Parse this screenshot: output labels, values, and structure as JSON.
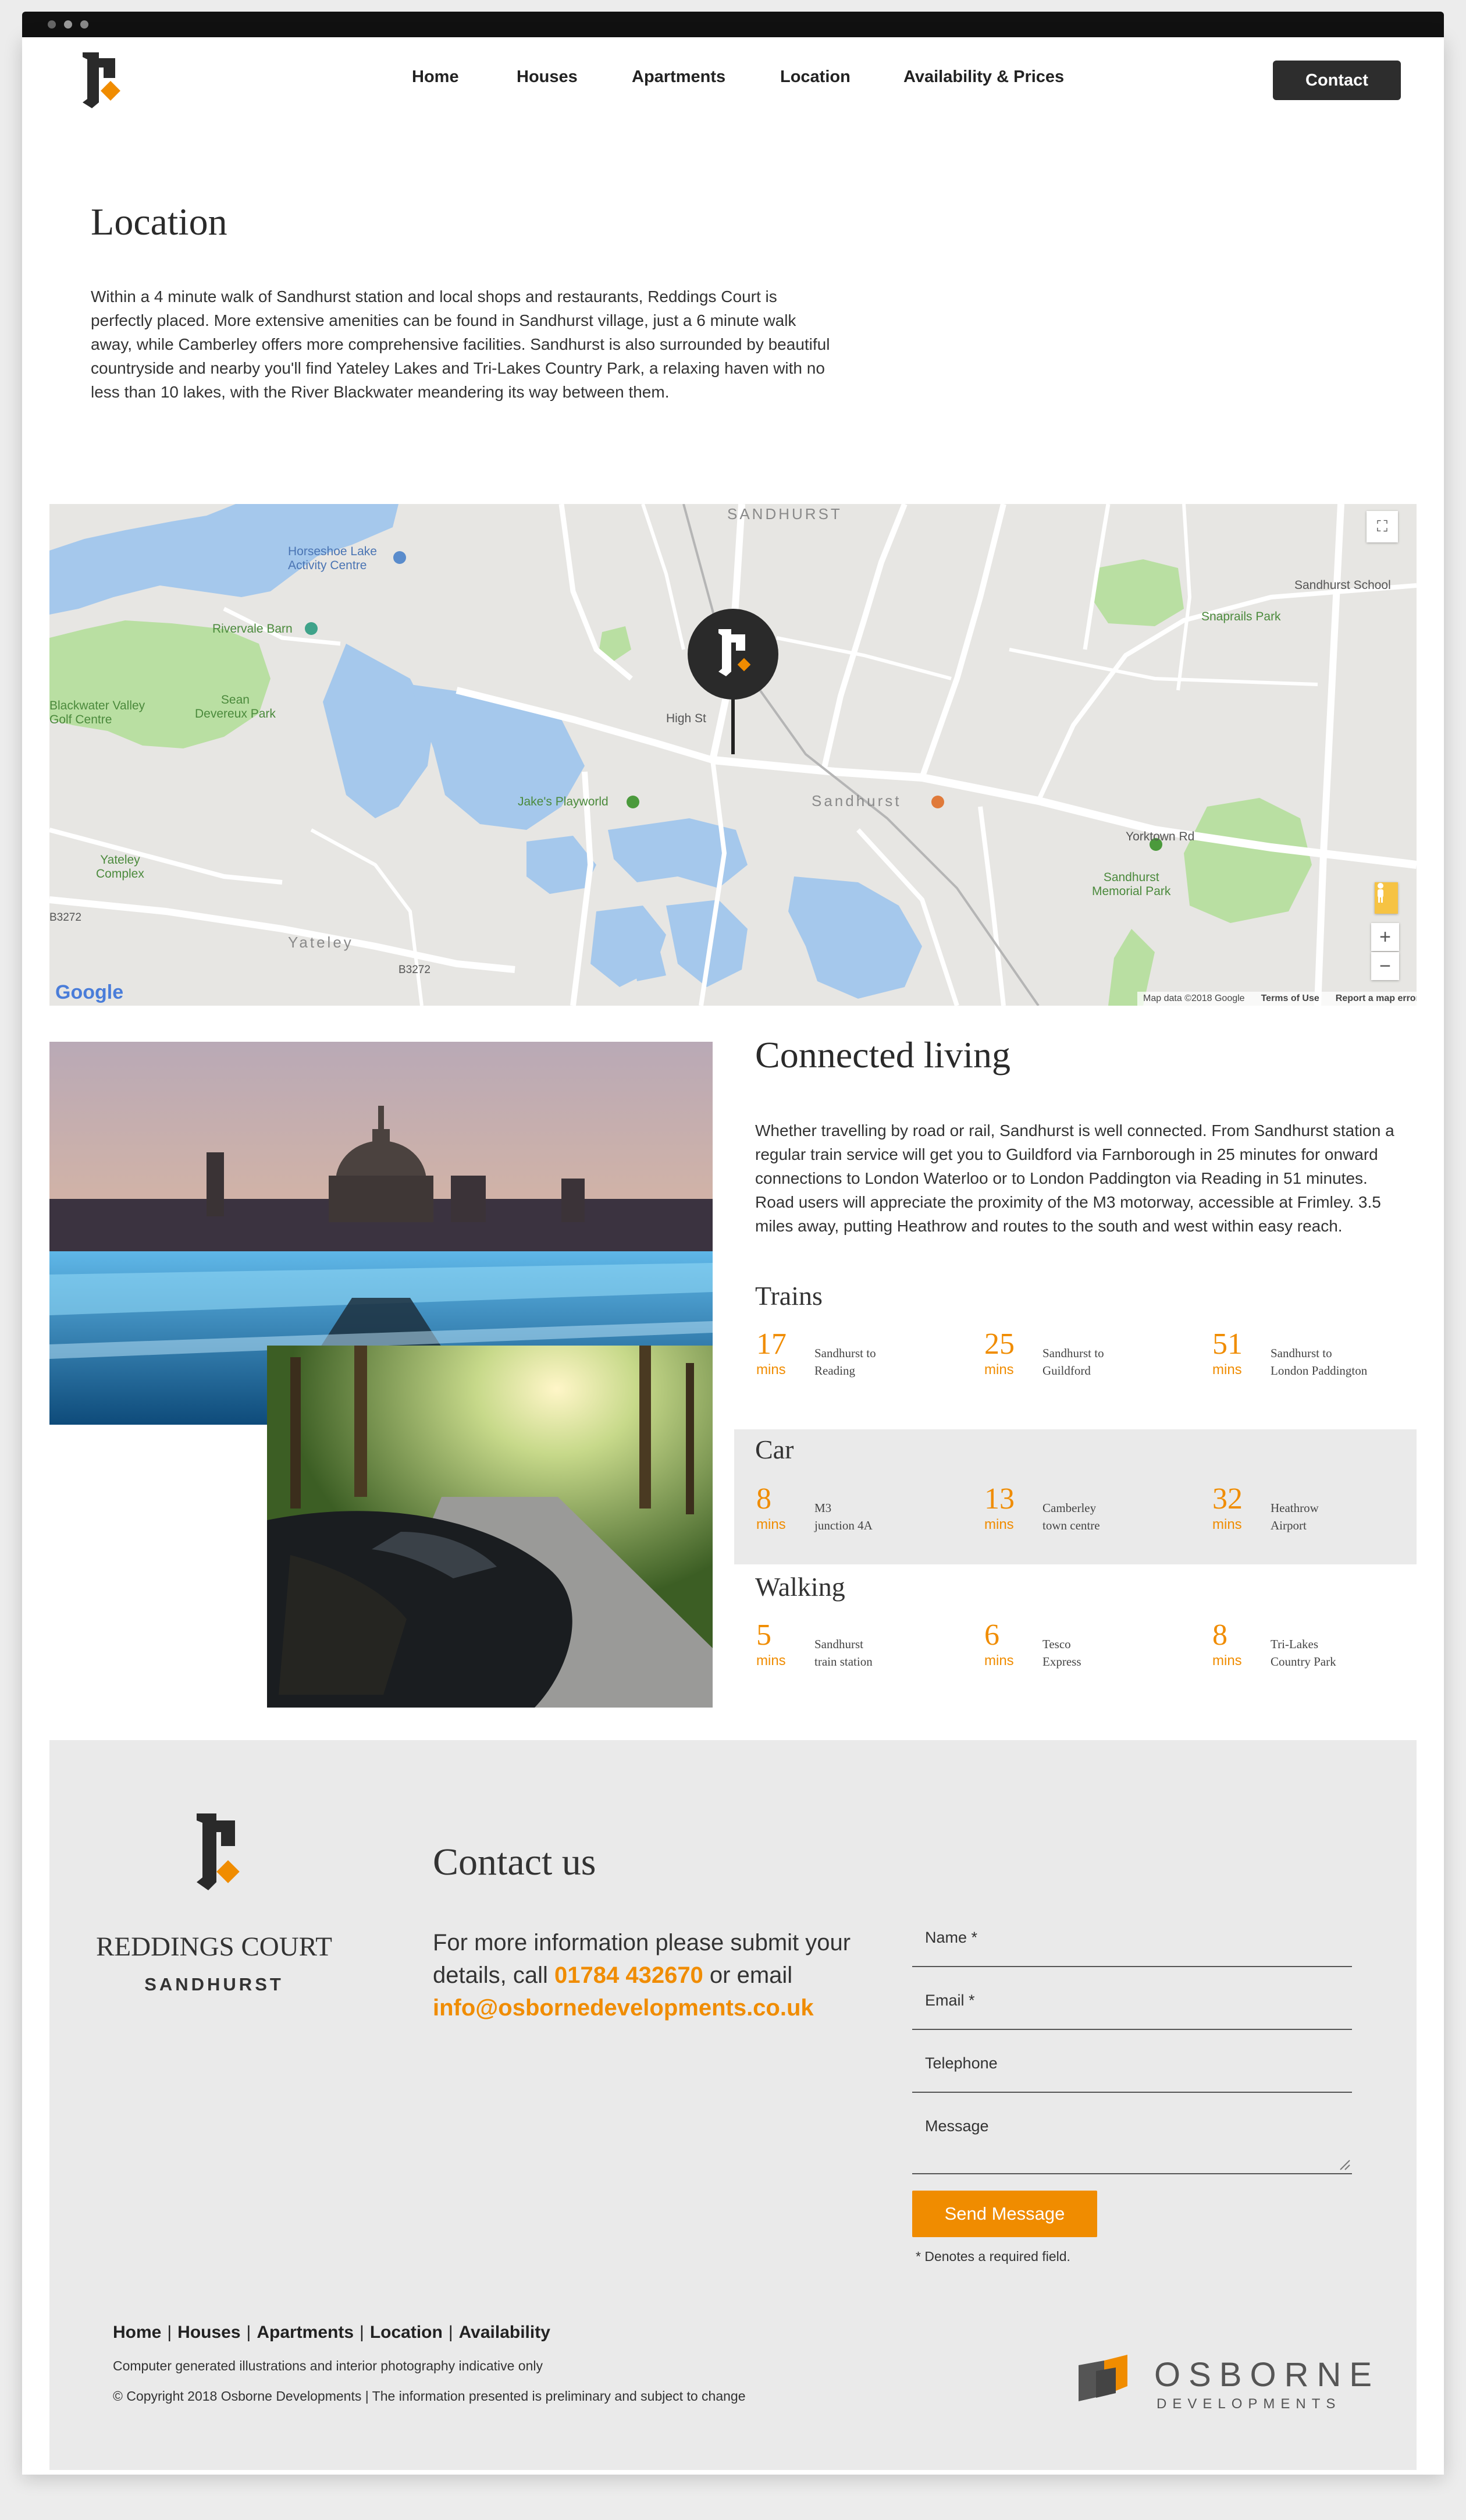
{
  "nav": {
    "items": [
      "Home",
      "Houses",
      "Apartments",
      "Location",
      "Availability & Prices"
    ],
    "contact_button": "Contact"
  },
  "location": {
    "title": "Location",
    "text": "Within a 4 minute walk of Sandhurst station and local shops and restaurants, Reddings Court is perfectly placed. More extensive amenities can be found in Sandhurst village, just a 6 minute walk away, while Camberley offers more comprehensive facilities. Sandhurst is also surrounded by beautiful countryside and nearby you'll find Yateley Lakes and Tri-Lakes Country Park, a relaxing haven with no less than 10 lakes, with the River Blackwater meandering its way between them."
  },
  "map": {
    "labels": {
      "sandhurst_top": "SANDHURST",
      "horseshoe": "Horseshoe Lake\nActivity Centre",
      "rivervale": "Rivervale Barn",
      "blackwater": "Blackwater Valley\nGolf Centre",
      "sean": "Sean\nDevereux Park",
      "snaprails": "Snaprails Park",
      "sandhurst_school": "Sandhurst School",
      "jakes": "Jake's Playworld",
      "sandhurst_town": "Sandhurst",
      "memorial": "Sandhurst\nMemorial Park",
      "yateley_complex": "Yateley\nComplex",
      "yateley": "Yateley",
      "high_st": "High St",
      "yorktown": "Yorktown Rd",
      "b3272a": "B3272",
      "b3272b": "B3272"
    },
    "attribution": "Map data ©2018 Google",
    "terms": "Terms of Use",
    "report": "Report a map error",
    "google": "Google",
    "zoom_in": "+",
    "zoom_out": "−"
  },
  "connected": {
    "title": "Connected living",
    "text": "Whether travelling by road or rail, Sandhurst is well connected. From Sandhurst station a regular train service will get you to Guildford via Farnborough in 25 minutes for onward connections to London Waterloo or to London Paddington via Reading in 51 minutes. Road users will appreciate the proximity of the M3 motorway, accessible at Frimley. 3.5 miles away, putting Heathrow and routes to the south and west within easy reach.",
    "groups": [
      {
        "title": "Trains",
        "stats": [
          {
            "num": "17",
            "unit": "mins",
            "desc": "Sandhurst to\nReading"
          },
          {
            "num": "25",
            "unit": "mins",
            "desc": "Sandhurst to\nGuildford"
          },
          {
            "num": "51",
            "unit": "mins",
            "desc": "Sandhurst to\nLondon Paddington"
          }
        ]
      },
      {
        "title": "Car",
        "stats": [
          {
            "num": "8",
            "unit": "mins",
            "desc": "M3\njunction 4A"
          },
          {
            "num": "13",
            "unit": "mins",
            "desc": "Camberley\ntown centre"
          },
          {
            "num": "32",
            "unit": "mins",
            "desc": "Heathrow\nAirport"
          }
        ]
      },
      {
        "title": "Walking",
        "stats": [
          {
            "num": "5",
            "unit": "mins",
            "desc": "Sandhurst\ntrain station"
          },
          {
            "num": "6",
            "unit": "mins",
            "desc": "Tesco\nExpress"
          },
          {
            "num": "8",
            "unit": "mins",
            "desc": "Tri-Lakes\nCountry Park"
          }
        ]
      }
    ]
  },
  "brand": {
    "name": "REDDINGS COURT",
    "sub": "SANDHURST"
  },
  "contact": {
    "title": "Contact us",
    "text_pre": "For more information please submit your details, call ",
    "phone": "01784 432670",
    "text_mid": " or email ",
    "email": "info@osbornedevelopments.co.uk",
    "fields": [
      "Name *",
      "Email *",
      "Telephone",
      "Message"
    ],
    "send": "Send Message",
    "required_note": "* Denotes a required field."
  },
  "footer": {
    "nav": [
      "Home",
      "Houses",
      "Apartments",
      "Location",
      "Availability"
    ],
    "separator": "|",
    "disclaimer": "Computer generated illustrations and interior photography indicative only",
    "copyright": "© Copyright 2018 Osborne Developments | The information presented is preliminary and subject to change",
    "osborne_name": "OSBORNE",
    "osborne_sub": "DEVELOPMENTS"
  },
  "colors": {
    "accent": "#f08c00",
    "dark": "#2d2d2d",
    "panel": "#eaeaea"
  }
}
